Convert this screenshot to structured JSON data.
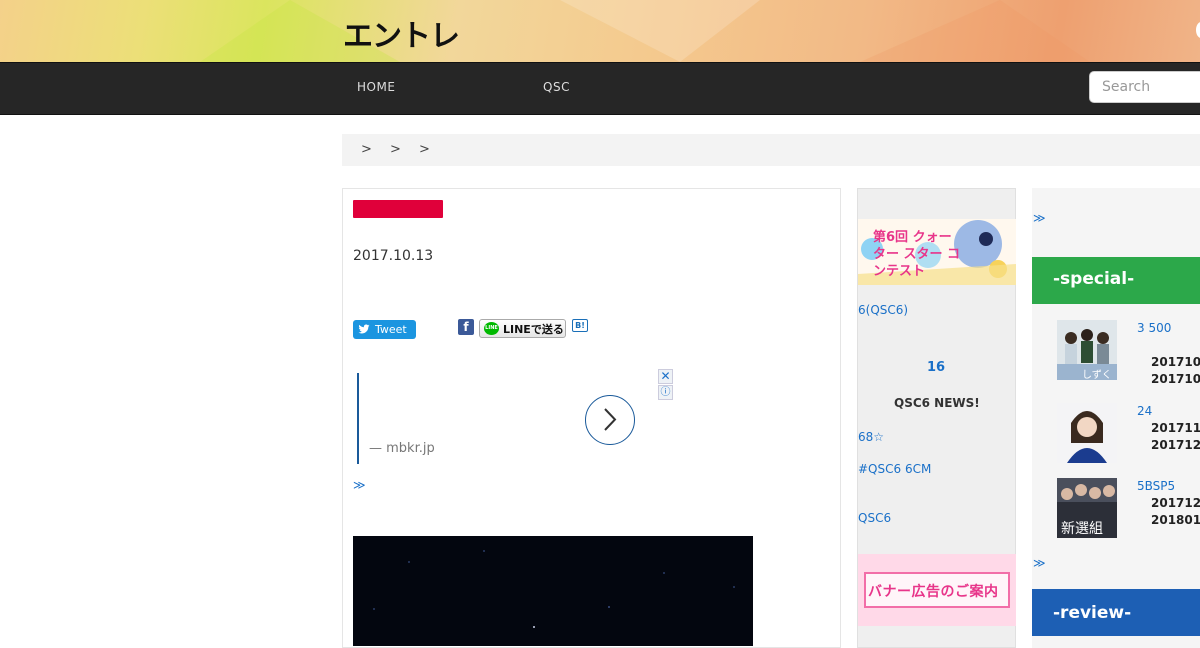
{
  "header": {
    "logo": "エントレ"
  },
  "nav": {
    "items": [
      {
        "label": "HOME"
      },
      {
        "label": "QSC"
      }
    ],
    "search_placeholder": "Search"
  },
  "breadcrumb": {
    "text": "> > >"
  },
  "article": {
    "date": "2017.10.13",
    "share": {
      "tweet": "Tweet",
      "facebook": "f",
      "line": "LINEで送る",
      "line_icon": "LINE",
      "hatena": "B!"
    },
    "ad": {
      "source": "— mbkr.jp",
      "close": "✕",
      "info": "ⓘ"
    },
    "more": "≫"
  },
  "mid_sidebar": {
    "banner_text": "第6回 クォーター スター コンテスト",
    "links": [
      "6(QSC6)",
      "68☆",
      "#QSC6  6CM",
      "QSC6"
    ],
    "count": "16",
    "news": "QSC6 NEWS!",
    "ad_banner": "バナー広告のご案内"
  },
  "right_sidebar": {
    "more_top": "≫",
    "special_title": "-special-",
    "items": [
      {
        "caption": "3  500",
        "date1": "201710",
        "date2": "201710",
        "thumb_text": "しずく"
      },
      {
        "caption": "24",
        "date1": "201711",
        "date2": "201712",
        "thumb_text": ""
      },
      {
        "caption": "5BSP5",
        "date1": "201712",
        "date2": "201801",
        "thumb_text": "新選組"
      }
    ],
    "more_bottom": "≫",
    "review_title": "-review-"
  },
  "colors": {
    "nav_bg": "#262626",
    "category_badge": "#e0003a",
    "special_green": "#2ca84a",
    "review_blue": "#1d5fb4",
    "link_blue": "#1a70c8"
  }
}
